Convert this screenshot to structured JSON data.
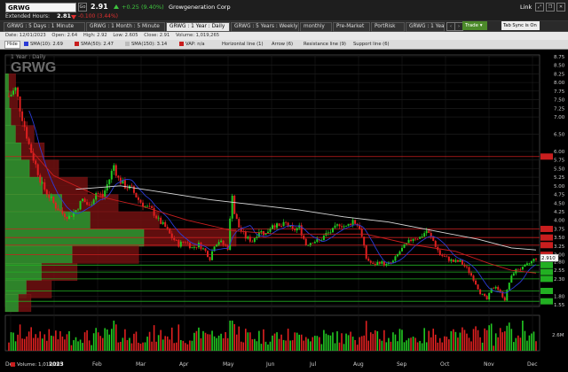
{
  "header": {
    "symbol": "GRWG",
    "go_label": "Go",
    "last_price": "2.91",
    "change": "+0.25 (9.40%)",
    "company": "Growgeneration Corp",
    "link_label": "Link",
    "extended_label": "Extended Hours:",
    "extended_price": "2.81",
    "extended_change": "-0.100 (3.44%)"
  },
  "tabs": [
    {
      "label": "GRWG : 5 Days : 1 Minute"
    },
    {
      "label": "GRWG : 1 Month : 5 Minute"
    },
    {
      "label": "GRWG : 1 Year : Daily"
    },
    {
      "label": "GRWG : 5 Years : Weekly"
    },
    {
      "label": "monthly"
    },
    {
      "label": "Pre-Market"
    },
    {
      "label": "PortRisk"
    },
    {
      "label": "GRWG : 1 Year"
    }
  ],
  "trade_label": "Trade",
  "sync_label": "Tab Sync is On",
  "info_bar": {
    "date": "Date: 12/01/2023",
    "open": "Open: 2.64",
    "high": "High: 2.92",
    "low": "Low: 2.605",
    "close": "Close: 2.91",
    "volume": "Volume: 1,019,265"
  },
  "toolbar": {
    "hide": "Hide",
    "sma10": "SMA(10): 2.69",
    "sma50": "SMA(50): 2.47",
    "sma150": "SMA(150): 3.14",
    "vap": "VAP: n/a",
    "hline": "Horizontal line (1)",
    "arrow": "Arrow (6)",
    "resistance": "Resistance line (9)",
    "support": "Support line (6)"
  },
  "colors": {
    "sma10": "#2b3bd6",
    "sma50": "#c81e1e",
    "sma150": "#d8d8d8",
    "vap": "#c81e1e",
    "up": "#22c922",
    "down": "#e02020",
    "resistance": "#c81e1e",
    "support": "#22b022"
  },
  "watermark": "GRWG",
  "chart_subtitle": "1 Year : Daily",
  "volume_label": "Volume: 1,019,265",
  "volume_tick": "2.6M",
  "chart_data": {
    "type": "candlestick",
    "x_ticks": [
      "Dec",
      "2023",
      "Feb",
      "Mar",
      "Apr",
      "May",
      "Jun",
      "Jul",
      "Aug",
      "Sep",
      "Oct",
      "Nov",
      "Dec"
    ],
    "y_ticks": [
      "1.55",
      "1.80",
      "2.30",
      "2.55",
      "2.80",
      "3.00",
      "3.25",
      "3.50",
      "3.75",
      "4.00",
      "4.25",
      "4.50",
      "4.75",
      "5.00",
      "5.25",
      "5.50",
      "5.75",
      "6.00",
      "6.50",
      "7.00",
      "7.25",
      "7.50",
      "7.75",
      "8.00",
      "8.25",
      "8.50",
      "8.75"
    ],
    "ylim": [
      1.5,
      8.8
    ],
    "resistance_levels": [
      "5.85",
      "3.00",
      "3.28",
      "3.50",
      "3.75"
    ],
    "support_levels": [
      "2.70",
      "2.50",
      "2.30",
      "1.95",
      "1.65"
    ],
    "last_price_tag": "2.910",
    "price_path": [
      [
        0,
        7.6
      ],
      [
        3,
        7.8
      ],
      [
        6,
        7.0
      ],
      [
        9,
        6.2
      ],
      [
        12,
        5.6
      ],
      [
        15,
        5.0
      ],
      [
        18,
        4.7
      ],
      [
        21,
        4.4
      ],
      [
        24,
        4.2
      ],
      [
        27,
        4.1
      ],
      [
        30,
        4.3
      ],
      [
        33,
        4.6
      ],
      [
        36,
        4.4
      ],
      [
        39,
        4.8
      ],
      [
        42,
        4.7
      ],
      [
        45,
        5.2
      ],
      [
        47,
        5.6
      ],
      [
        49,
        5.2
      ],
      [
        52,
        5.0
      ],
      [
        55,
        4.9
      ],
      [
        58,
        4.6
      ],
      [
        61,
        4.4
      ],
      [
        64,
        4.3
      ],
      [
        67,
        4.0
      ],
      [
        70,
        3.8
      ],
      [
        73,
        3.5
      ],
      [
        76,
        3.3
      ],
      [
        79,
        3.4
      ],
      [
        82,
        3.2
      ],
      [
        85,
        3.3
      ],
      [
        88,
        3.1
      ],
      [
        90,
        2.9
      ],
      [
        92,
        3.3
      ],
      [
        94,
        3.4
      ],
      [
        96,
        3.3
      ],
      [
        98,
        3.2
      ],
      [
        100,
        4.8
      ],
      [
        101,
        4.2
      ],
      [
        103,
        3.8
      ],
      [
        106,
        3.5
      ],
      [
        109,
        3.4
      ],
      [
        112,
        3.7
      ],
      [
        115,
        3.6
      ],
      [
        118,
        3.9
      ],
      [
        121,
        3.8
      ],
      [
        124,
        3.9
      ],
      [
        127,
        3.7
      ],
      [
        130,
        3.8
      ],
      [
        133,
        3.3
      ],
      [
        136,
        3.4
      ],
      [
        139,
        3.4
      ],
      [
        142,
        3.6
      ],
      [
        145,
        3.7
      ],
      [
        148,
        3.9
      ],
      [
        151,
        3.8
      ],
      [
        154,
        4.0
      ],
      [
        157,
        3.8
      ],
      [
        160,
        2.9
      ],
      [
        163,
        2.7
      ],
      [
        166,
        2.8
      ],
      [
        169,
        2.7
      ],
      [
        172,
        2.8
      ],
      [
        175,
        3.1
      ],
      [
        178,
        3.3
      ],
      [
        181,
        3.5
      ],
      [
        184,
        3.5
      ],
      [
        187,
        3.7
      ],
      [
        190,
        3.4
      ],
      [
        193,
        3.0
      ],
      [
        196,
        2.9
      ],
      [
        199,
        2.8
      ],
      [
        202,
        2.8
      ],
      [
        205,
        2.6
      ],
      [
        208,
        2.3
      ],
      [
        211,
        1.9
      ],
      [
        214,
        1.7
      ],
      [
        216,
        2.0
      ],
      [
        218,
        2.1
      ],
      [
        220,
        1.9
      ],
      [
        222,
        1.7
      ],
      [
        224,
        2.2
      ],
      [
        226,
        2.5
      ],
      [
        228,
        2.6
      ],
      [
        230,
        2.6
      ],
      [
        232,
        2.7
      ],
      [
        234,
        2.8
      ],
      [
        236,
        2.91
      ]
    ],
    "sma50_path": [
      [
        9,
        6.1
      ],
      [
        20,
        5.3
      ],
      [
        40,
        4.7
      ],
      [
        60,
        4.4
      ],
      [
        80,
        4.0
      ],
      [
        100,
        3.7
      ],
      [
        120,
        3.6
      ],
      [
        140,
        3.6
      ],
      [
        160,
        3.6
      ],
      [
        180,
        3.3
      ],
      [
        200,
        3.1
      ],
      [
        215,
        2.75
      ],
      [
        225,
        2.55
      ],
      [
        236,
        2.47
      ]
    ],
    "sma150_path": [
      [
        30,
        4.9
      ],
      [
        50,
        5.0
      ],
      [
        70,
        4.8
      ],
      [
        90,
        4.6
      ],
      [
        110,
        4.45
      ],
      [
        130,
        4.3
      ],
      [
        150,
        4.1
      ],
      [
        170,
        3.95
      ],
      [
        190,
        3.7
      ],
      [
        210,
        3.45
      ],
      [
        225,
        3.2
      ],
      [
        236,
        3.14
      ]
    ],
    "vap_bins": [
      {
        "price": 8.0,
        "value": 10,
        "up": 0.3
      },
      {
        "price": 7.5,
        "value": 12,
        "up": 0.3
      },
      {
        "price": 7.0,
        "value": 15,
        "up": 0.35
      },
      {
        "price": 6.5,
        "value": 28,
        "up": 0.35
      },
      {
        "price": 6.0,
        "value": 38,
        "up": 0.4
      },
      {
        "price": 5.5,
        "value": 52,
        "up": 0.45
      },
      {
        "price": 5.0,
        "value": 80,
        "up": 0.45
      },
      {
        "price": 4.5,
        "value": 110,
        "up": 0.5
      },
      {
        "price": 4.0,
        "value": 150,
        "up": 0.55
      },
      {
        "price": 3.5,
        "value": 225,
        "up": 0.6
      },
      {
        "price": 3.0,
        "value": 130,
        "up": 0.5
      },
      {
        "price": 2.5,
        "value": 70,
        "up": 0.5
      },
      {
        "price": 2.0,
        "value": 45,
        "up": 0.45
      },
      {
        "price": 1.6,
        "value": 25,
        "up": 0.5
      }
    ]
  }
}
